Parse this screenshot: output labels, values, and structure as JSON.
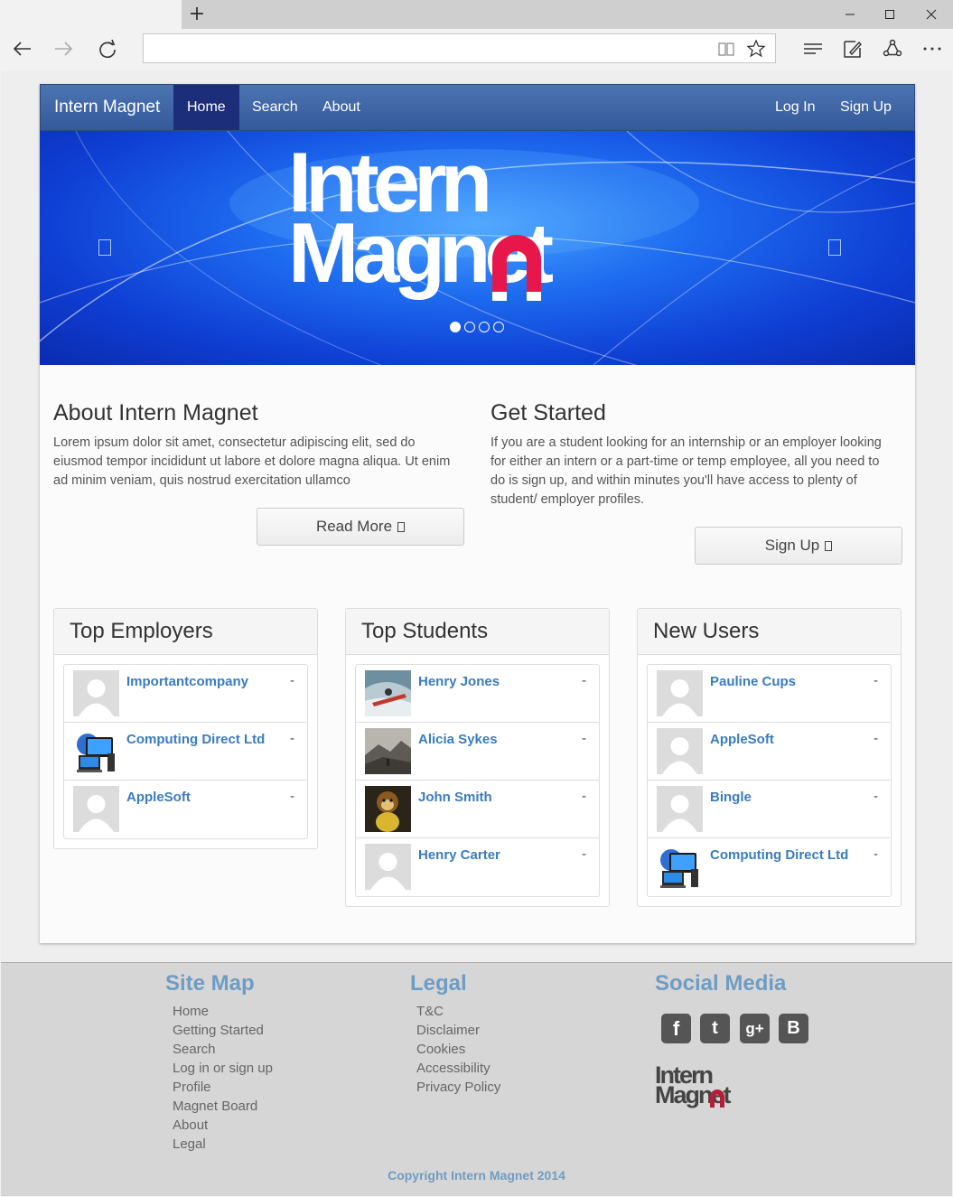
{
  "browser": {
    "new_tab_label": "+",
    "url": ""
  },
  "navbar": {
    "brand": "Intern Magnet",
    "links": [
      "Home",
      "Search",
      "About"
    ],
    "right_links": [
      "Log In",
      "Sign Up"
    ]
  },
  "carousel": {
    "logo_text_line1": "Intern",
    "logo_text_line2": "Magnet",
    "active_slide": 1,
    "slide_count": 4
  },
  "about": {
    "title": "About Intern Magnet",
    "text": "Lorem ipsum dolor sit amet, consectetur adipiscing elit, sed do eiusmod tempor incididunt ut labore et dolore magna aliqua. Ut enim ad minim veniam, quis nostrud exercitation ullamco",
    "button": "Read More"
  },
  "get_started": {
    "title": "Get Started",
    "text": "If you are a student looking for an internship or an employer looking for either an intern or a part-time or temp employee, all you need to do is sign up, and within minutes you'll have access to plenty of student/ employer profiles.",
    "button": "Sign Up"
  },
  "panels": {
    "employers": {
      "title": "Top Employers",
      "items": [
        {
          "name": "Importantcompany",
          "value": "-",
          "avatar": "default-avatar"
        },
        {
          "name": "Computing Direct Ltd",
          "value": "-",
          "avatar": "computer-avatar"
        },
        {
          "name": "AppleSoft",
          "value": "-",
          "avatar": "default-avatar"
        }
      ]
    },
    "students": {
      "title": "Top Students",
      "items": [
        {
          "name": "Henry Jones",
          "value": "-",
          "avatar": "kayak-photo"
        },
        {
          "name": "Alicia Sykes",
          "value": "-",
          "avatar": "mountain-photo"
        },
        {
          "name": "John Smith",
          "value": "-",
          "avatar": "monkey-photo"
        },
        {
          "name": "Henry Carter",
          "value": "-",
          "avatar": "default-avatar"
        }
      ]
    },
    "new_users": {
      "title": "New Users",
      "items": [
        {
          "name": "Pauline Cups",
          "value": "-",
          "avatar": "default-avatar"
        },
        {
          "name": "AppleSoft",
          "value": "-",
          "avatar": "default-avatar"
        },
        {
          "name": "Bingle",
          "value": "-",
          "avatar": "default-avatar"
        },
        {
          "name": "Computing Direct Ltd",
          "value": "-",
          "avatar": "computer-avatar"
        }
      ]
    }
  },
  "footer": {
    "sitemap": {
      "title": "Site Map",
      "links": [
        "Home",
        "Getting Started",
        "Search",
        "Log in or sign up",
        "Profile",
        "Magnet Board",
        "About",
        "Legal"
      ]
    },
    "legal": {
      "title": "Legal",
      "links": [
        "T&C",
        "Disclaimer",
        "Cookies",
        "Accessibility",
        "Privacy Policy"
      ]
    },
    "social": {
      "title": "Social Media",
      "icons": [
        "facebook-icon",
        "twitter-icon",
        "google-plus-icon",
        "blogger-icon"
      ],
      "icon_glyphs": [
        "f",
        "t",
        "g+",
        "B"
      ],
      "logo_line1": "Intern",
      "logo_line2": "Magnet"
    },
    "copyright": "Copyright Intern Magnet 2014"
  },
  "colors": {
    "navbar": "#3f64a6",
    "active_nav": "#1c2d7a",
    "link": "#3a7cc0",
    "footer_heading": "#6f9cc3",
    "magnet_red": "#e8174b"
  }
}
